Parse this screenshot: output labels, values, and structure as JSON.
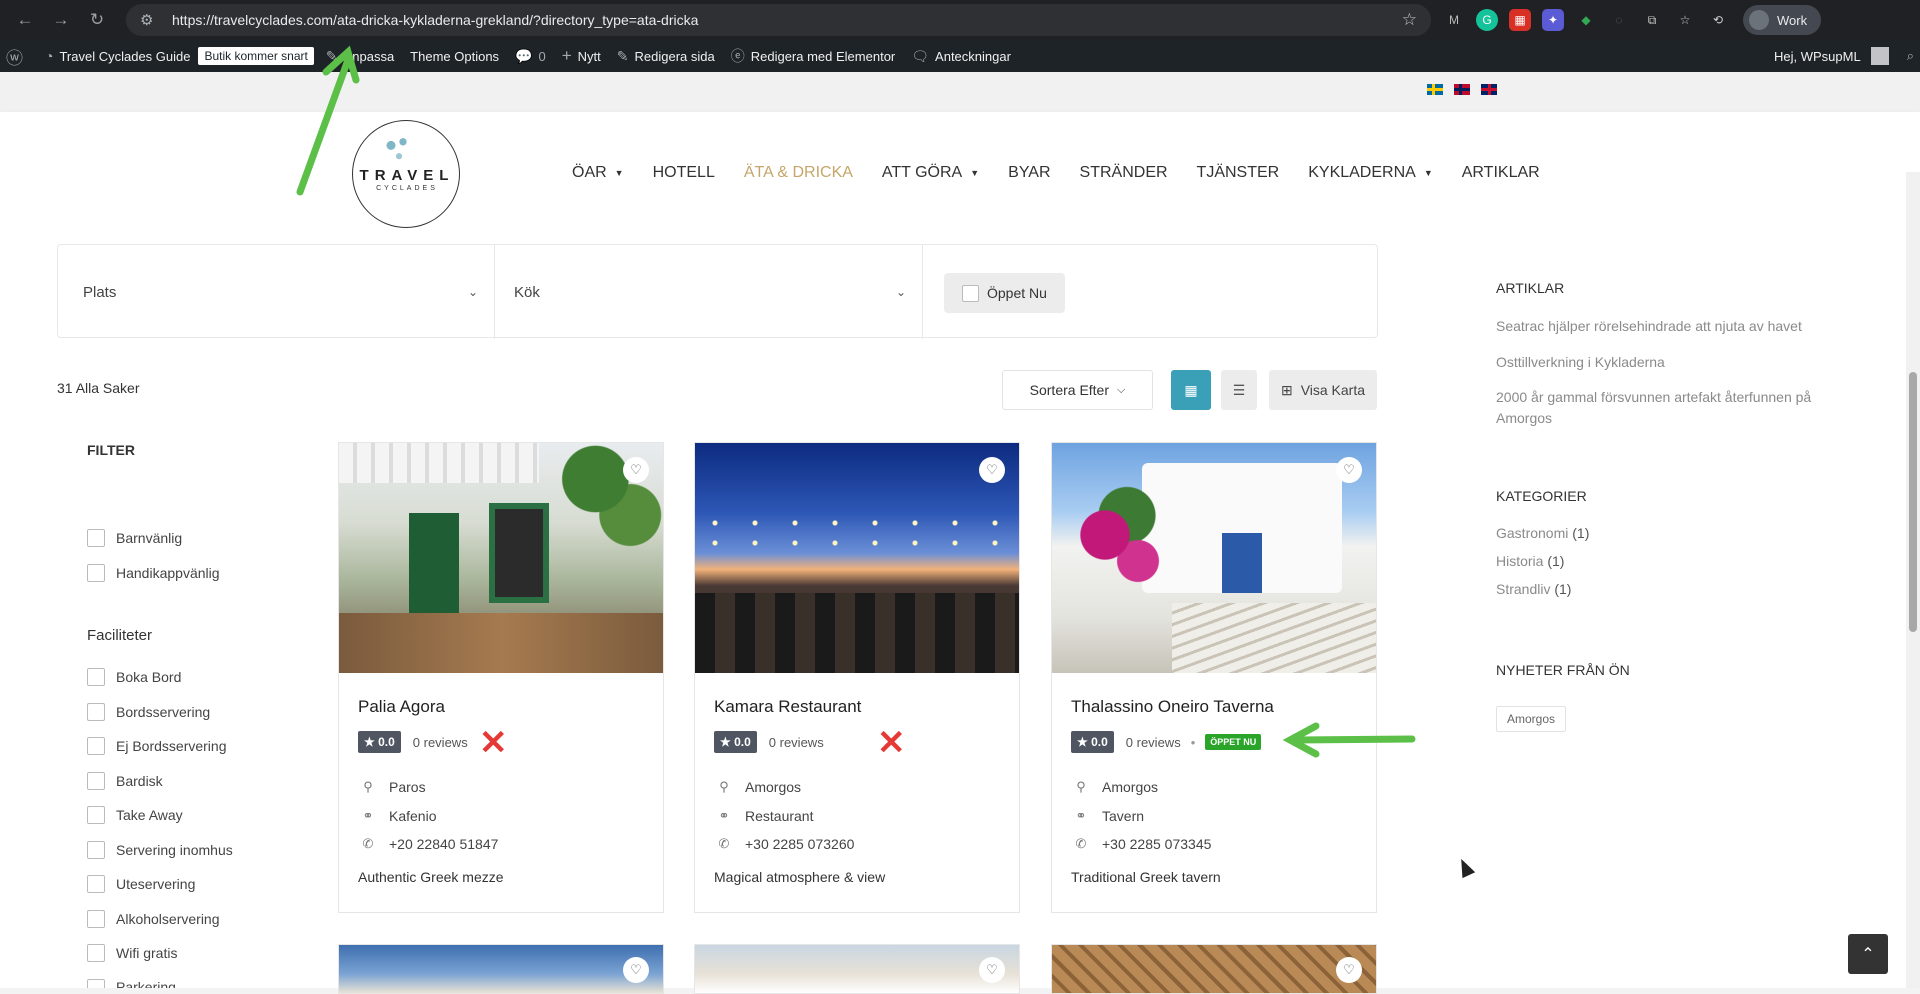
{
  "browser": {
    "url": "https://travelcyclades.com/ata-dricka-kykladerna-grekland/?directory_type=ata-dricka",
    "profile_label": "Work"
  },
  "adminbar": {
    "site_name": "Travel Cyclades Guide",
    "badge": "Butik kommer snart",
    "customize": "Anpassa",
    "theme_options": "Theme Options",
    "comments_count": "0",
    "new": "Nytt",
    "edit_page": "Redigera sida",
    "edit_elementor": "Redigera med Elementor",
    "notes": "Anteckningar",
    "greeting": "Hej, WPsupML"
  },
  "logo": {
    "main": "TRAVEL",
    "sub": "CYCLADES"
  },
  "menu": [
    {
      "label": "ÖAR",
      "dropdown": true
    },
    {
      "label": "HOTELL"
    },
    {
      "label": "ÄTA & DRICKA",
      "active": true
    },
    {
      "label": "ATT GÖRA",
      "dropdown": true
    },
    {
      "label": "BYAR"
    },
    {
      "label": "STRÄNDER"
    },
    {
      "label": "TJÄNSTER"
    },
    {
      "label": "KYKLADERNA",
      "dropdown": true
    },
    {
      "label": "ARTIKLAR"
    }
  ],
  "filterbar": {
    "place": "Plats",
    "kitchen": "Kök",
    "open_now": "Öppet Nu"
  },
  "results": {
    "count": "31 Alla Saker",
    "sort": "Sortera Efter",
    "map": "Visa Karta"
  },
  "filter": {
    "title": "FILTER",
    "top_items": [
      "Barnvänlig",
      "Handikappvänlig"
    ],
    "facilities_title": "Faciliteter",
    "facilities": [
      "Boka Bord",
      "Bordsservering",
      "Ej Bordsservering",
      "Bardisk",
      "Take Away",
      "Servering inomhus",
      "Uteservering",
      "Alkoholservering",
      "Wifi gratis",
      "Parkering"
    ]
  },
  "cards": [
    {
      "title": "Palia Agora",
      "rating": "0.0",
      "reviews": "0 reviews",
      "location": "Paros",
      "category": "Kafenio",
      "phone": "+20 22840 51847",
      "desc": "Authentic Greek mezze",
      "open": false
    },
    {
      "title": "Kamara Restaurant",
      "rating": "0.0",
      "reviews": "0 reviews",
      "location": "Amorgos",
      "category": "Restaurant",
      "phone": "+30 2285 073260",
      "desc": "Magical atmosphere & view",
      "open": false
    },
    {
      "title": "Thalassino Oneiro Taverna",
      "rating": "0.0",
      "reviews": "0 reviews",
      "location": "Amorgos",
      "category": "Tavern",
      "phone": "+30 2285 073345",
      "desc": "Traditional Greek tavern",
      "open": true,
      "open_label": "ÖPPET NU"
    }
  ],
  "sidebar": {
    "articles_title": "ARTIKLAR",
    "articles": [
      "Seatrac hjälper rörelsehindrade att njuta av havet",
      "Osttillverkning i Kykladerna",
      "2000 år gammal försvunnen artefakt återfunnen på Amorgos"
    ],
    "categories_title": "KATEGORIER",
    "categories": [
      {
        "name": "Gastronomi",
        "count": "(1)"
      },
      {
        "name": "Historia",
        "count": "(1)"
      },
      {
        "name": "Strandliv",
        "count": "(1)"
      }
    ],
    "news_title": "NYHETER FRÅN ÖN",
    "tag": "Amorgos"
  },
  "colors": {
    "accent": "#3aa0b8",
    "active_menu": "#c5a66a",
    "open_badge": "#2aa52a",
    "annotation_arrow": "#5cc048",
    "x_mark": "#e53935"
  }
}
